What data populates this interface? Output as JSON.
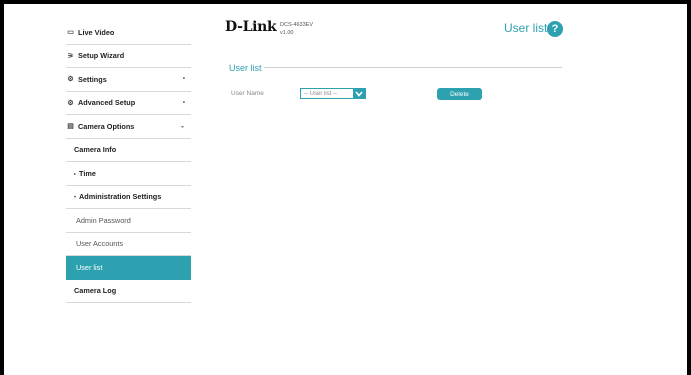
{
  "sidebar": {
    "items": [
      {
        "label": "Live Video",
        "icon": "video-icon",
        "glyph": "▭"
      },
      {
        "label": "Setup Wizard",
        "icon": "wand-icon",
        "glyph": "⚞"
      },
      {
        "label": "Settings",
        "icon": "gear-icon",
        "glyph": "⚙",
        "arrow": "•"
      },
      {
        "label": "Advanced Setup",
        "icon": "advanced-gear-icon",
        "glyph": "⚙",
        "arrow": "•"
      },
      {
        "label": "Camera Options",
        "icon": "document-icon",
        "glyph": "▤",
        "arrow": "⌄"
      },
      {
        "label": "Camera Info"
      },
      {
        "label": "Time",
        "prefix": "▸"
      },
      {
        "label": "Administration Settings",
        "prefix": "▾"
      },
      {
        "label": "Admin Password"
      },
      {
        "label": "User Accounts"
      },
      {
        "label": "User list"
      },
      {
        "label": "Camera Log"
      }
    ]
  },
  "header": {
    "logo": "D-Link",
    "model": "DCS-4633EV",
    "version": "v1.00",
    "title": "User list",
    "help": "?"
  },
  "section": {
    "title": "User list",
    "field_label": "User Name",
    "select_value": "-- User list --",
    "delete_label": "Delete"
  },
  "colors": {
    "accent": "#2ea1b0"
  }
}
